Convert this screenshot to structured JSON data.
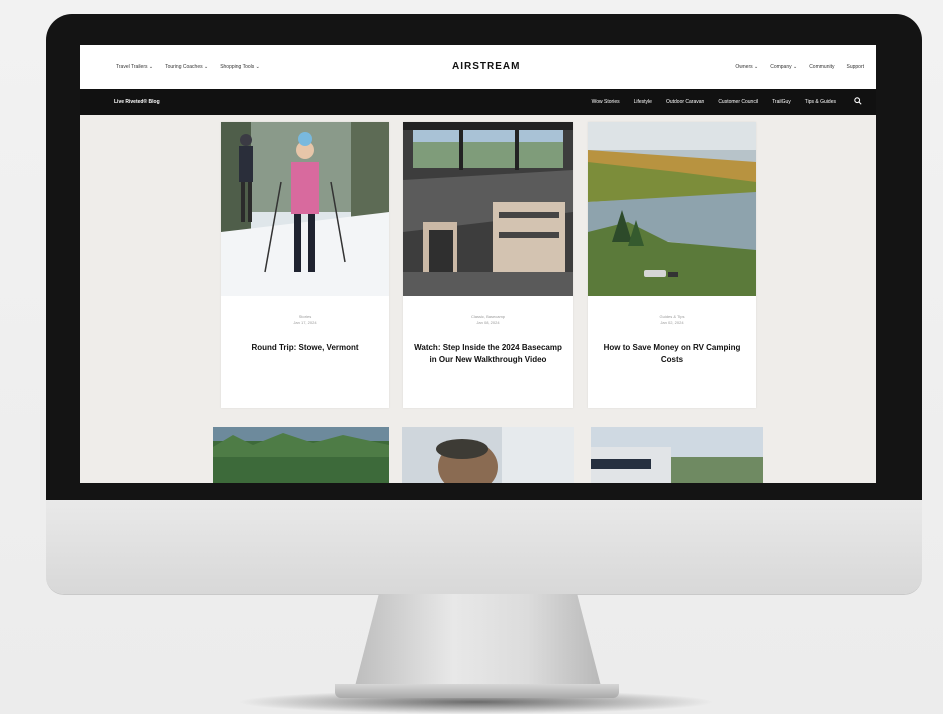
{
  "topnav": {
    "left": [
      "Travel Trailers ⌄",
      "Touring Coaches ⌄",
      "Shopping Tools ⌄"
    ],
    "brand": "AIRSTREAM",
    "right": [
      "Owners ⌄",
      "Company ⌄",
      "Community",
      "Support"
    ]
  },
  "subnav": {
    "blog": "Live Riveted® Blog",
    "links": [
      "Wow Stories",
      "Lifestyle",
      "Outdoor Caravan",
      "Customer Council",
      "TrailGuy",
      "Tips & Guides"
    ]
  },
  "cards": [
    {
      "meta": "Stories",
      "date": "Jan 17, 2024",
      "title": "Round Trip: Stowe, Vermont"
    },
    {
      "meta": "Classic, Basecamp",
      "date": "Jan 08, 2024",
      "title": "Watch: Step Inside the 2024 Basecamp in Our New Walkthrough Video"
    },
    {
      "meta": "Guides & Tips",
      "date": "Jan 02, 2024",
      "title": "How to Save Money on RV Camping Costs"
    }
  ],
  "colors": {
    "bezel": "#141414",
    "screen_bg": "#efedea",
    "nav_dark": "#111111"
  }
}
